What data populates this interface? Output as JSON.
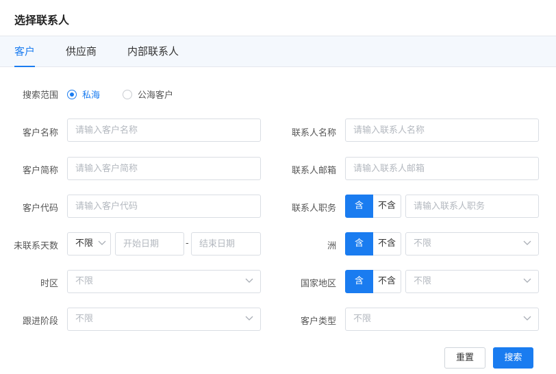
{
  "dialog": {
    "title": "选择联系人"
  },
  "tabs": [
    {
      "label": "客户",
      "active": true
    },
    {
      "label": "供应商",
      "active": false
    },
    {
      "label": "内部联系人",
      "active": false
    }
  ],
  "scope": {
    "label": "搜索范围",
    "options": [
      {
        "label": "私海",
        "checked": true
      },
      {
        "label": "公海客户",
        "checked": false
      }
    ]
  },
  "fields": {
    "customer_name": {
      "label": "客户名称",
      "placeholder": "请输入客户名称"
    },
    "customer_short": {
      "label": "客户简称",
      "placeholder": "请输入客户简称"
    },
    "customer_code": {
      "label": "客户代码",
      "placeholder": "请输入客户代码"
    },
    "uncontacted_days": {
      "label": "未联系天数",
      "select_value": "不限",
      "start_placeholder": "开始日期",
      "separator": "-",
      "end_placeholder": "结束日期"
    },
    "timezone": {
      "label": "时区",
      "value": "不限"
    },
    "stage": {
      "label": "跟进阶段",
      "value": "不限"
    },
    "contact_name": {
      "label": "联系人名称",
      "placeholder": "请输入联系人名称"
    },
    "contact_email": {
      "label": "联系人邮箱",
      "placeholder": "请输入联系人邮箱"
    },
    "contact_title": {
      "label": "联系人职务",
      "include": "含",
      "exclude": "不含",
      "placeholder": "请输入联系人职务"
    },
    "continent": {
      "label": "洲",
      "include": "含",
      "exclude": "不含",
      "value": "不限"
    },
    "country": {
      "label": "国家地区",
      "include": "含",
      "exclude": "不含",
      "value": "不限"
    },
    "customer_type": {
      "label": "客户类型",
      "value": "不限"
    }
  },
  "footer": {
    "reset_label": "重置",
    "search_label": "搜索"
  },
  "colors": {
    "accent": "#1a7cf0",
    "tab_bg": "#f4f8fd",
    "border": "#d9dde3",
    "placeholder": "#b3b8bf"
  },
  "icons": {
    "dropdown": "chevron-down-icon"
  }
}
